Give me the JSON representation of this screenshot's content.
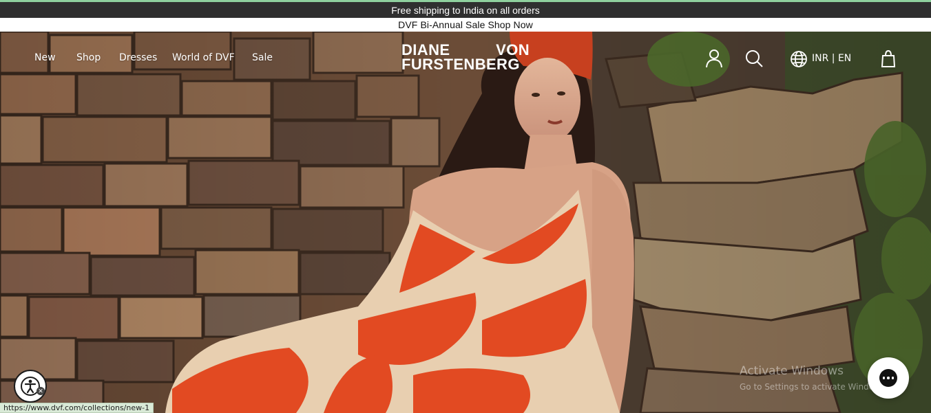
{
  "announcement": {
    "text": "Free shipping to India on all orders"
  },
  "promo": {
    "text": "DVF Bi-Annual Sale Shop Now"
  },
  "nav": {
    "items": [
      {
        "label": "New"
      },
      {
        "label": "Shop"
      },
      {
        "label": "Dresses"
      },
      {
        "label": "World of DVF"
      },
      {
        "label": "Sale"
      }
    ]
  },
  "logo": {
    "word1": "DIANE",
    "word2": "VON",
    "word3": "FURSTENBERG"
  },
  "header_actions": {
    "locale": "INR | EN",
    "icons": [
      "account-icon",
      "search-icon",
      "globe-icon",
      "bag-icon"
    ]
  },
  "widgets": {
    "accessibility_icon": "accessibility-icon",
    "chat_icon": "chat-icon"
  },
  "watermark": {
    "title": "Activate Windows",
    "subtitle": "Go to Settings to activate Windows."
  },
  "status_bar": {
    "url": "https://www.dvf.com/collections/new-1"
  },
  "colors": {
    "announcement_bg": "#2f2f2f",
    "dress_orange": "#e24a22",
    "dress_cream": "#e8cfb0",
    "scarf": "#c7401f"
  }
}
